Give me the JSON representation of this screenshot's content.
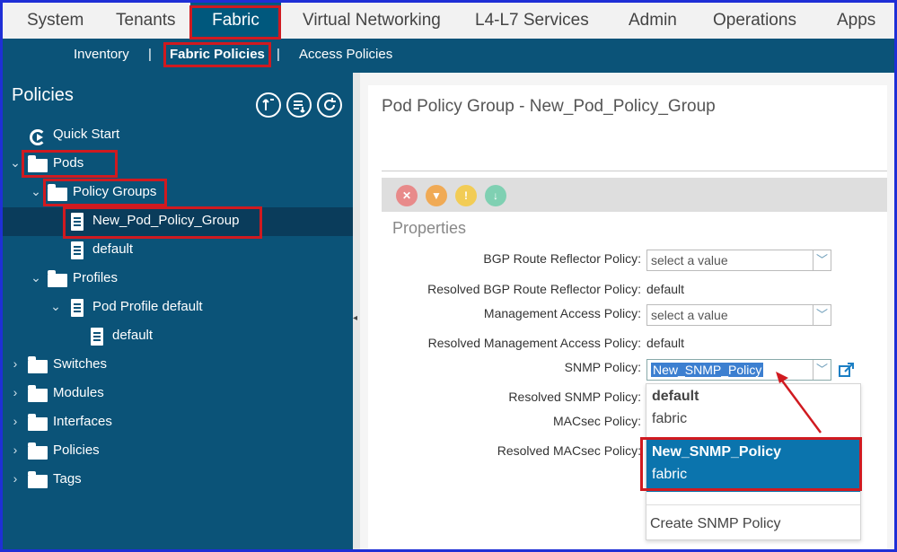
{
  "top_nav": {
    "tabs": [
      "System",
      "Tenants",
      "Fabric",
      "Virtual Networking",
      "L4-L7 Services",
      "Admin",
      "Operations",
      "Apps"
    ],
    "active": "Fabric"
  },
  "sub_nav": {
    "items": [
      "Inventory",
      "Fabric Policies",
      "Access Policies"
    ],
    "separators": [
      "|",
      "|"
    ],
    "active": "Fabric Policies"
  },
  "sidebar": {
    "title": "Policies",
    "header_icons": [
      "collapse-all-icon",
      "expand-list-icon",
      "refresh-icon"
    ],
    "tree": [
      {
        "label": "Quick Start",
        "icon": "quick-start-icon"
      },
      {
        "label": "Pods",
        "icon": "folder-icon",
        "expanded": true
      },
      {
        "label": "Policy Groups",
        "icon": "folder-icon",
        "expanded": true
      },
      {
        "label": "New_Pod_Policy_Group",
        "icon": "document-icon",
        "selected": true
      },
      {
        "label": "default",
        "icon": "document-icon"
      },
      {
        "label": "Profiles",
        "icon": "folder-icon",
        "expanded": true
      },
      {
        "label": "Pod Profile default",
        "icon": "document-icon",
        "expanded": true
      },
      {
        "label": "default",
        "icon": "document-icon"
      },
      {
        "label": "Switches",
        "icon": "folder-icon"
      },
      {
        "label": "Modules",
        "icon": "folder-icon"
      },
      {
        "label": "Interfaces",
        "icon": "folder-icon"
      },
      {
        "label": "Policies",
        "icon": "folder-icon"
      },
      {
        "label": "Tags",
        "icon": "folder-icon"
      }
    ]
  },
  "main": {
    "title": "Pod Policy Group - New_Pod_Policy_Group",
    "fault_icons": [
      {
        "name": "critical-fault-icon",
        "color": "#e86b6b",
        "glyph": "✕"
      },
      {
        "name": "major-fault-icon",
        "color": "#f0a23c",
        "glyph": "▼"
      },
      {
        "name": "minor-fault-icon",
        "color": "#f0c83c",
        "glyph": "!"
      },
      {
        "name": "warning-fault-icon",
        "color": "#6fc8a8",
        "glyph": "↓"
      }
    ],
    "section": "Properties",
    "fields": {
      "bgp_label": "BGP Route Reflector Policy:",
      "bgp_value": "select a value",
      "resolved_bgp_label": "Resolved BGP Route Reflector Policy:",
      "resolved_bgp_value": "default",
      "mgmt_label": "Management Access Policy:",
      "mgmt_value": "select a value",
      "resolved_mgmt_label": "Resolved Management Access Policy:",
      "resolved_mgmt_value": "default",
      "snmp_label": "SNMP Policy:",
      "snmp_value": "New_SNMP_Policy",
      "resolved_snmp_label": "Resolved SNMP Policy:",
      "macsec_label": "MACsec Policy:",
      "resolved_macsec_label": "Resolved MACsec Policy:"
    },
    "snmp_dropdown": {
      "options": [
        {
          "name": "default",
          "scope": "fabric"
        },
        {
          "name": "New_SNMP_Policy",
          "scope": "fabric",
          "highlighted": true
        }
      ],
      "create_label": "Create SNMP Policy"
    }
  },
  "colors": {
    "nav_bg": "#0b5378",
    "active_tab": "#00587d",
    "highlight": "#0b74ad",
    "annotation": "#d01a20"
  }
}
